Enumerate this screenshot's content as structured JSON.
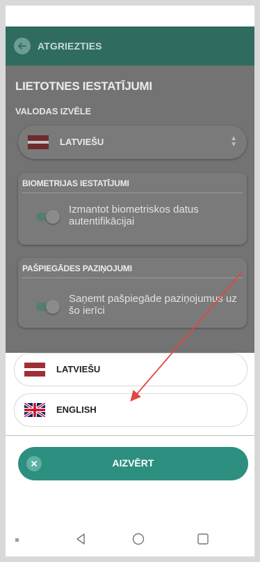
{
  "header": {
    "back_label": "ATGRIEZTIES"
  },
  "settings": {
    "title": "LIETOTNES IESTATĪJUMI",
    "language_heading": "VALODAS IZVĒLE",
    "language_selected": "LATVIEŠU",
    "biometrics": {
      "title": "BIOMETRIJAS IESTATĪJUMI",
      "toggle_label": "Izmantot biometriskos datus autentifikācijai",
      "toggle_on": true
    },
    "notifications": {
      "title": "PAŠPIEGĀDES PAZIŅOJUMI",
      "toggle_label": "Saņemt pašpiegāde paziņojumus uz šo ierīci",
      "toggle_on": true
    }
  },
  "language_sheet": {
    "options": [
      {
        "label": "LATVIEŠU",
        "flag": "latvia-flag-icon"
      },
      {
        "label": "ENGLISH",
        "flag": "uk-flag-icon"
      }
    ],
    "close_label": "AIZVĒRT"
  },
  "nav_icons": [
    "menu-dot-icon",
    "back-triangle-icon",
    "home-circle-icon",
    "recents-square-icon"
  ],
  "colors": {
    "appbar": "#2f6c5f",
    "accent": "#2c8f80",
    "overlay": "#737373",
    "annotation_arrow": "#e2473f"
  }
}
